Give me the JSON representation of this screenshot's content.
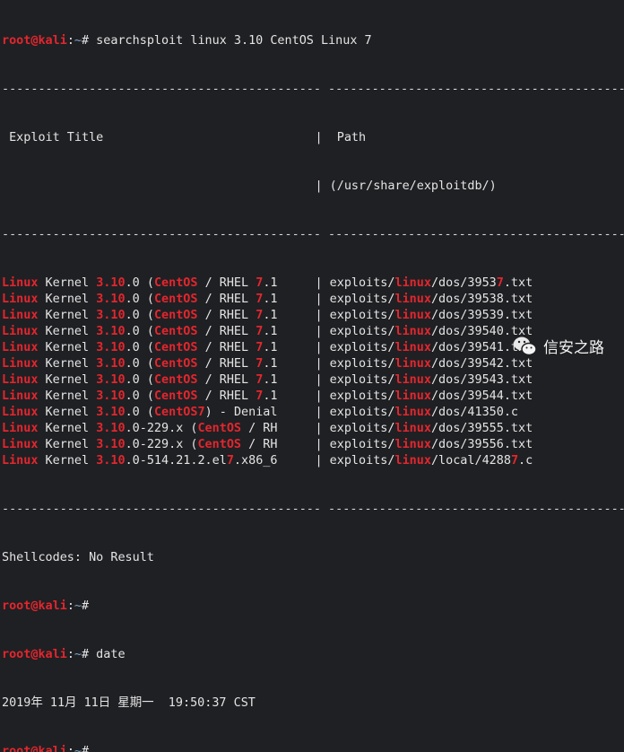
{
  "prompt": {
    "user": "root@kali",
    "colon": ":",
    "path": "~",
    "hash": "#"
  },
  "command1": " searchsploit linux 3.10 CentOS Linux 7",
  "separator": "-------------------------------------------- -----------------------------------------",
  "header": {
    "title": " Exploit Title",
    "path_label": "|  Path",
    "path_dir": "| (/usr/share/exploitdb/)"
  },
  "rows": [
    {
      "title": [
        [
          "Linux",
          1
        ],
        [
          " Kernel ",
          0
        ],
        [
          "3.10",
          1
        ],
        [
          ".0 (",
          0
        ],
        [
          "CentOS",
          1
        ],
        [
          " / RHEL ",
          0
        ],
        [
          "7",
          1
        ],
        [
          ".1",
          0
        ]
      ],
      "path": [
        [
          "| exploits/",
          0
        ],
        [
          "linux",
          1
        ],
        [
          "/dos/3953",
          0
        ],
        [
          "7",
          1
        ],
        [
          ".txt",
          0
        ]
      ]
    },
    {
      "title": [
        [
          "Linux",
          1
        ],
        [
          " Kernel ",
          0
        ],
        [
          "3.10",
          1
        ],
        [
          ".0 (",
          0
        ],
        [
          "CentOS",
          1
        ],
        [
          " / RHEL ",
          0
        ],
        [
          "7",
          1
        ],
        [
          ".1",
          0
        ]
      ],
      "path": [
        [
          "| exploits/",
          0
        ],
        [
          "linux",
          1
        ],
        [
          "/dos/39538.txt",
          0
        ]
      ]
    },
    {
      "title": [
        [
          "Linux",
          1
        ],
        [
          " Kernel ",
          0
        ],
        [
          "3.10",
          1
        ],
        [
          ".0 (",
          0
        ],
        [
          "CentOS",
          1
        ],
        [
          " / RHEL ",
          0
        ],
        [
          "7",
          1
        ],
        [
          ".1",
          0
        ]
      ],
      "path": [
        [
          "| exploits/",
          0
        ],
        [
          "linux",
          1
        ],
        [
          "/dos/39539.txt",
          0
        ]
      ]
    },
    {
      "title": [
        [
          "Linux",
          1
        ],
        [
          " Kernel ",
          0
        ],
        [
          "3.10",
          1
        ],
        [
          ".0 (",
          0
        ],
        [
          "CentOS",
          1
        ],
        [
          " / RHEL ",
          0
        ],
        [
          "7",
          1
        ],
        [
          ".1",
          0
        ]
      ],
      "path": [
        [
          "| exploits/",
          0
        ],
        [
          "linux",
          1
        ],
        [
          "/dos/39540.txt",
          0
        ]
      ]
    },
    {
      "title": [
        [
          "Linux",
          1
        ],
        [
          " Kernel ",
          0
        ],
        [
          "3.10",
          1
        ],
        [
          ".0 (",
          0
        ],
        [
          "CentOS",
          1
        ],
        [
          " / RHEL ",
          0
        ],
        [
          "7",
          1
        ],
        [
          ".1",
          0
        ]
      ],
      "path": [
        [
          "| exploits/",
          0
        ],
        [
          "linux",
          1
        ],
        [
          "/dos/39541.txt",
          0
        ]
      ]
    },
    {
      "title": [
        [
          "Linux",
          1
        ],
        [
          " Kernel ",
          0
        ],
        [
          "3.10",
          1
        ],
        [
          ".0 (",
          0
        ],
        [
          "CentOS",
          1
        ],
        [
          " / RHEL ",
          0
        ],
        [
          "7",
          1
        ],
        [
          ".1",
          0
        ]
      ],
      "path": [
        [
          "| exploits/",
          0
        ],
        [
          "linux",
          1
        ],
        [
          "/dos/39542.txt",
          0
        ]
      ]
    },
    {
      "title": [
        [
          "Linux",
          1
        ],
        [
          " Kernel ",
          0
        ],
        [
          "3.10",
          1
        ],
        [
          ".0 (",
          0
        ],
        [
          "CentOS",
          1
        ],
        [
          " / RHEL ",
          0
        ],
        [
          "7",
          1
        ],
        [
          ".1",
          0
        ]
      ],
      "path": [
        [
          "| exploits/",
          0
        ],
        [
          "linux",
          1
        ],
        [
          "/dos/39543.txt",
          0
        ]
      ]
    },
    {
      "title": [
        [
          "Linux",
          1
        ],
        [
          " Kernel ",
          0
        ],
        [
          "3.10",
          1
        ],
        [
          ".0 (",
          0
        ],
        [
          "CentOS",
          1
        ],
        [
          " / RHEL ",
          0
        ],
        [
          "7",
          1
        ],
        [
          ".1",
          0
        ]
      ],
      "path": [
        [
          "| exploits/",
          0
        ],
        [
          "linux",
          1
        ],
        [
          "/dos/39544.txt",
          0
        ]
      ]
    },
    {
      "title": [
        [
          "Linux",
          1
        ],
        [
          " Kernel ",
          0
        ],
        [
          "3.10",
          1
        ],
        [
          ".0 (",
          0
        ],
        [
          "CentOS7",
          1
        ],
        [
          ") - Denial",
          0
        ]
      ],
      "path": [
        [
          "| exploits/",
          0
        ],
        [
          "linux",
          1
        ],
        [
          "/dos/41350.c",
          0
        ]
      ]
    },
    {
      "title": [
        [
          "Linux",
          1
        ],
        [
          " Kernel ",
          0
        ],
        [
          "3.10",
          1
        ],
        [
          ".0-229.x (",
          0
        ],
        [
          "CentOS",
          1
        ],
        [
          " / RH",
          0
        ]
      ],
      "path": [
        [
          "| exploits/",
          0
        ],
        [
          "linux",
          1
        ],
        [
          "/dos/39555.txt",
          0
        ]
      ]
    },
    {
      "title": [
        [
          "Linux",
          1
        ],
        [
          " Kernel ",
          0
        ],
        [
          "3.10",
          1
        ],
        [
          ".0-229.x (",
          0
        ],
        [
          "CentOS",
          1
        ],
        [
          " / RH",
          0
        ]
      ],
      "path": [
        [
          "| exploits/",
          0
        ],
        [
          "linux",
          1
        ],
        [
          "/dos/39556.txt",
          0
        ]
      ]
    },
    {
      "title": [
        [
          "Linux",
          1
        ],
        [
          " Kernel ",
          0
        ],
        [
          "3.10",
          1
        ],
        [
          ".0-514.21.2.el",
          0
        ],
        [
          "7",
          1
        ],
        [
          ".x86_6",
          0
        ]
      ],
      "path": [
        [
          "| exploits/",
          0
        ],
        [
          "linux",
          1
        ],
        [
          "/local/4288",
          0
        ],
        [
          "7",
          1
        ],
        [
          ".c",
          0
        ]
      ]
    }
  ],
  "shellcodes": "Shellcodes: No Result",
  "command2": " date",
  "date_output": "2019年 11月 11日 星期一  19:50:37 CST",
  "watermark": "信安之路",
  "colors": {
    "background": "#1f2023",
    "highlight": "#e3262e",
    "text": "#e4e4e4",
    "tilde": "#7aa2c8"
  }
}
